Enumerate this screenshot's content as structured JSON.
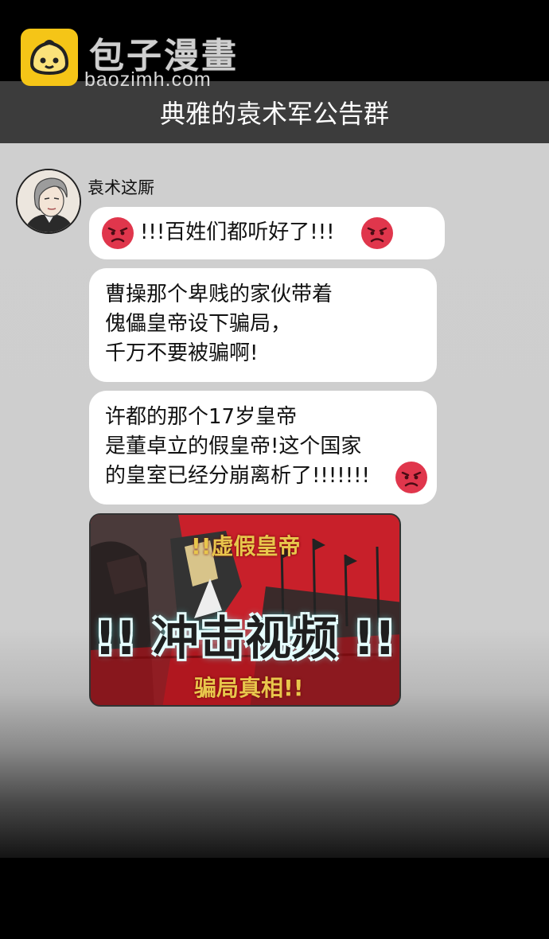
{
  "watermark": {
    "site_name": "包子漫畫",
    "site_url": "baozimh.com"
  },
  "header": {
    "group_title": "典雅的袁术军公告群"
  },
  "chat": {
    "sender_name": "袁术这厮",
    "messages": [
      {
        "text": "!!!百姓们都听好了!!!",
        "emoji": "angry-face-icon"
      },
      {
        "text": "曹操那个卑贱的家伙带着\n傀儡皇帝设下骗局，\n千万不要被骗啊!"
      },
      {
        "text": "许都的那个17岁皇帝\n是董卓立的假皇帝!这个国家\n的皇室已经分崩离析了!!!!!!!",
        "emoji": "angry-face-icon"
      }
    ],
    "video": {
      "label_top": "!!虚假皇帝",
      "label_main": "!! 冲击视频 !!",
      "label_bottom": "骗局真相!!"
    }
  },
  "colors": {
    "header_bg": "#3c3c3c",
    "chat_bg": "#cfcfcf",
    "logo_bg": "#f5c517",
    "emoji_red": "#e0364c",
    "video_bg": "#c8202a"
  }
}
